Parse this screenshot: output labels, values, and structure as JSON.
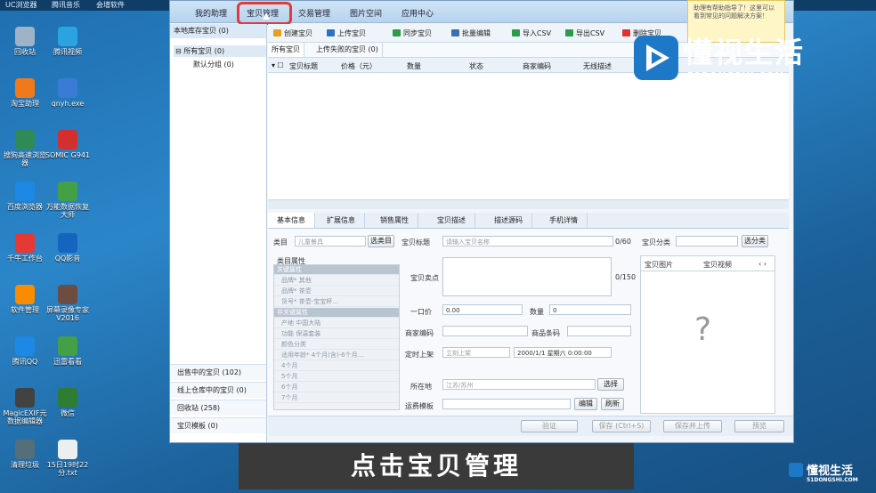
{
  "taskbar_top": {
    "items": [
      "UC浏览器",
      "腾讯音乐",
      "会增软件"
    ]
  },
  "desktop_icons": [
    {
      "label": "回收站",
      "color": "#9fb3c8"
    },
    {
      "label": "腾讯视频",
      "color": "#2aa3e0"
    },
    {
      "label": "淘宝助理",
      "color": "#f07a1a"
    },
    {
      "label": "qnyh.exe",
      "color": "#3a7bd5"
    },
    {
      "label": "搜狗高速浏览器",
      "color": "#2e8b57"
    },
    {
      "label": "SOMIC G941",
      "color": "#d32f2f"
    },
    {
      "label": "百度浏览器",
      "color": "#1e88e5"
    },
    {
      "label": "万能数据恢复大师",
      "color": "#43a047"
    },
    {
      "label": "千牛工作台",
      "color": "#e53935"
    },
    {
      "label": "QQ影音",
      "color": "#1565c0"
    },
    {
      "label": "软件管理",
      "color": "#fb8c00"
    },
    {
      "label": "屏幕录像专家V2016",
      "color": "#6d4c41"
    },
    {
      "label": "腾讯QQ",
      "color": "#1e88e5"
    },
    {
      "label": "迅雷看看",
      "color": "#43a047"
    },
    {
      "label": "MagicEXIF元数据编辑器",
      "color": "#424242"
    },
    {
      "label": "微信",
      "color": "#2e7d32"
    },
    {
      "label": "清理垃圾",
      "color": "#546e7a"
    },
    {
      "label": "15日19时22分.txt",
      "color": "#eceff1"
    }
  ],
  "menu": {
    "items": [
      "我的助理",
      "宝贝管理",
      "交易管理",
      "图片空间",
      "应用中心"
    ],
    "active": "宝贝管理"
  },
  "left_panel": {
    "header": "本地库存宝贝 (0)",
    "tree": [
      "所有宝贝 (0)",
      "默认分组 (0)"
    ],
    "bottom_items": [
      "出售中的宝贝 (102)",
      "线上仓库中的宝贝 (0)",
      "回收站 (258)",
      "宝贝模板 (0)"
    ]
  },
  "toolbar": {
    "items": [
      {
        "label": "创建宝贝",
        "color": "#e6a11a"
      },
      {
        "label": "上传宝贝",
        "color": "#2b72c4"
      },
      {
        "label": "同步宝贝",
        "color": "#2b9c4a"
      },
      {
        "label": "批量编辑",
        "color": "#3d6fb0"
      },
      {
        "label": "导入CSV",
        "color": "#2b9c4a"
      },
      {
        "label": "导出CSV",
        "color": "#2b9c4a"
      },
      {
        "label": "删除宝贝",
        "color": "#d33"
      }
    ]
  },
  "subtabs": [
    "所有宝贝",
    "上传失败的宝贝 (0)"
  ],
  "columns": [
    "宝贝标题",
    "价格（元）",
    "数量",
    "状态",
    "商家编码",
    "无线描述"
  ],
  "detail_tabs": [
    "基本信息",
    "扩展信息",
    "销售属性",
    "宝贝描述",
    "描述源码",
    "手机详情"
  ],
  "detail": {
    "category_label": "类目",
    "category_value": "儿童餐具",
    "select_category_btn": "选类目",
    "attr_title": "类目属性",
    "attr_rows": [
      {
        "text": "关键属性",
        "section": true
      },
      {
        "text": "品牌*    其他",
        "section": false
      },
      {
        "text": "品牌*    茶壶",
        "section": false
      },
      {
        "text": "货号*    茶壶-宝宝杯...",
        "section": false
      },
      {
        "text": "非关键属性",
        "section": true
      },
      {
        "text": "产地     中国大陆",
        "section": false
      },
      {
        "text": "功能     保温套装",
        "section": false
      },
      {
        "text": "颜色分类",
        "section": false
      },
      {
        "text": "适用年龄*  4个月(含)-6个月...",
        "section": false
      },
      {
        "text": "4个月",
        "section": false
      },
      {
        "text": "5个月",
        "section": false
      },
      {
        "text": "6个月",
        "section": false
      },
      {
        "text": "7个月",
        "section": false
      }
    ],
    "title_label": "宝贝标题",
    "title_placeholder": "请输入宝贝名称",
    "title_count": "0/60",
    "selling_label": "宝贝卖点",
    "selling_count": "0/150",
    "price_label": "一口价",
    "price_value": "0.00",
    "qty_label": "数量",
    "qty_value": "0",
    "merchant_code_label": "商家编码",
    "barcode_label": "商品条码",
    "schedule_label": "定时上架",
    "schedule_value": "立刻上架",
    "schedule_date": "2000/1/1 星期六 0:00:00",
    "location_label": "所在地",
    "location_value": "江苏/苏州",
    "location_btn": "选择",
    "shipping_label": "运费模板",
    "edit_btn": "编辑",
    "refresh_btn": "刷新",
    "category_right_label": "宝贝分类",
    "category_right_btn": "选分类",
    "right_tabs": [
      "宝贝图片",
      "宝贝视频"
    ],
    "placeholder_glyph": "?"
  },
  "footer_buttons": [
    "验证",
    "保存 (Ctrl+S)",
    "保存并上传",
    "预览"
  ],
  "help_note": "助理有帮助指导了！这里可以看到常见的问题解决方案！",
  "caption": "点击宝贝管理",
  "watermark": {
    "brand": "懂视生活",
    "domain": "51DONGSHI.COM"
  }
}
